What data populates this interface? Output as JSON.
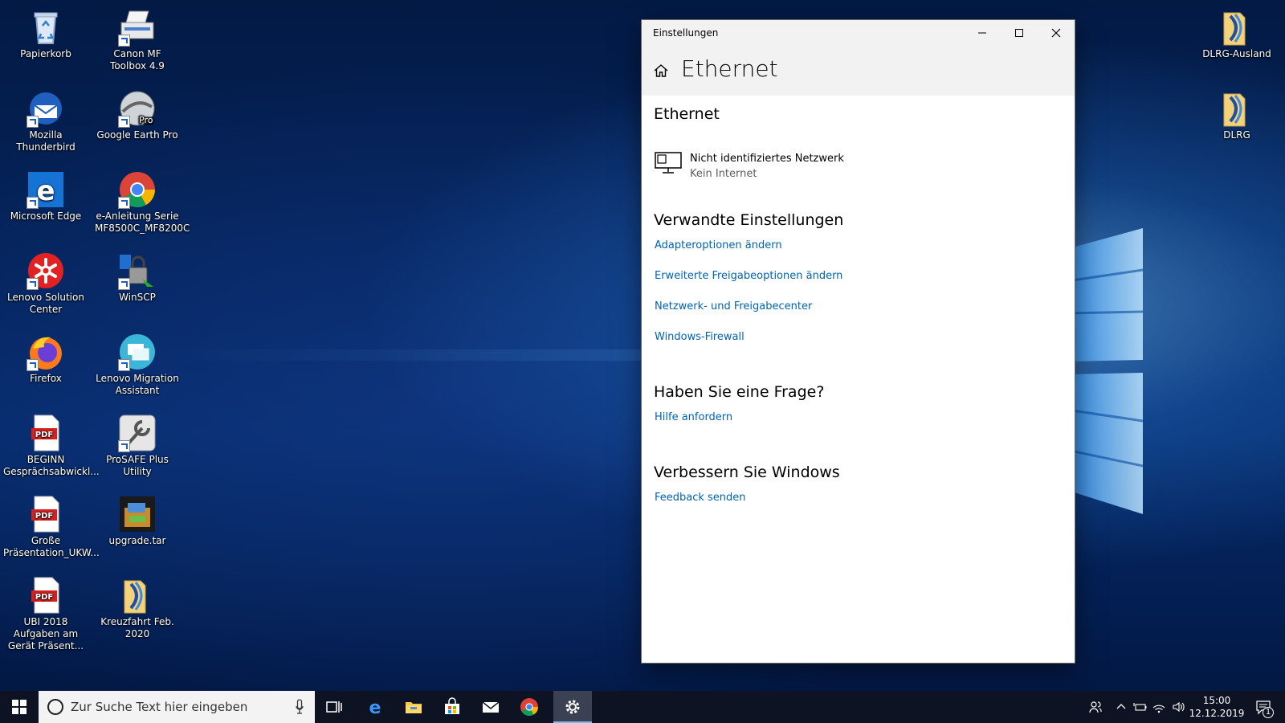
{
  "desktop": {
    "icons_left": [
      {
        "label": "Papierkorb",
        "icon": "recycle-bin-icon"
      },
      {
        "label": "Mozilla Thunderbird",
        "icon": "thunderbird-icon"
      },
      {
        "label": "Microsoft Edge",
        "icon": "edge-icon"
      },
      {
        "label": "Lenovo Solution Center",
        "icon": "lenovo-solution-center-icon"
      },
      {
        "label": "Firefox",
        "icon": "firefox-icon"
      },
      {
        "label": "BEGINN Gesprächsabwickl...",
        "icon": "pdf-icon"
      },
      {
        "label": "Große Präsentation_UKW...",
        "icon": "pdf-icon"
      },
      {
        "label": "UBI 2018 Aufgaben am Gerät Präsent...",
        "icon": "pdf-icon"
      }
    ],
    "icons_mid": [
      {
        "label": "Canon MF Toolbox 4.9",
        "icon": "canon-toolbox-icon"
      },
      {
        "label": "Google Earth Pro",
        "icon": "google-earth-icon"
      },
      {
        "label": "e-Anleitung Serie MF8500C_MF8200C",
        "icon": "chrome-icon"
      },
      {
        "label": "WinSCP",
        "icon": "winscp-icon"
      },
      {
        "label": "Lenovo Migration Assistant",
        "icon": "lenovo-migration-icon"
      },
      {
        "label": "ProSAFE Plus Utility",
        "icon": "prosafe-icon"
      },
      {
        "label": "upgrade.tar",
        "icon": "archive-icon"
      },
      {
        "label": "Kreuzfahrt Feb. 2020",
        "icon": "folder-icon"
      }
    ],
    "icons_right": [
      {
        "label": "DLRG-Ausland",
        "icon": "folder-icon"
      },
      {
        "label": "DLRG",
        "icon": "folder-icon"
      }
    ]
  },
  "window": {
    "title": "Einstellungen",
    "header_title": "Ethernet",
    "section_ethernet": "Ethernet",
    "network_name": "Nicht identifiziertes Netzwerk",
    "network_status": "Kein Internet",
    "related_heading": "Verwandte Einstellungen",
    "related_links": [
      "Adapteroptionen ändern",
      "Erweiterte Freigabeoptionen ändern",
      "Netzwerk- und Freigabecenter",
      "Windows-Firewall"
    ],
    "question_heading": "Haben Sie eine Frage?",
    "question_link": "Hilfe anfordern",
    "improve_heading": "Verbessern Sie Windows",
    "improve_link": "Feedback senden"
  },
  "taskbar": {
    "search_placeholder": "Zur Suche Text hier eingeben",
    "time": "15:00",
    "date": "12.12.2019",
    "notification_count": "1",
    "accent_color": "#76b9ed"
  }
}
